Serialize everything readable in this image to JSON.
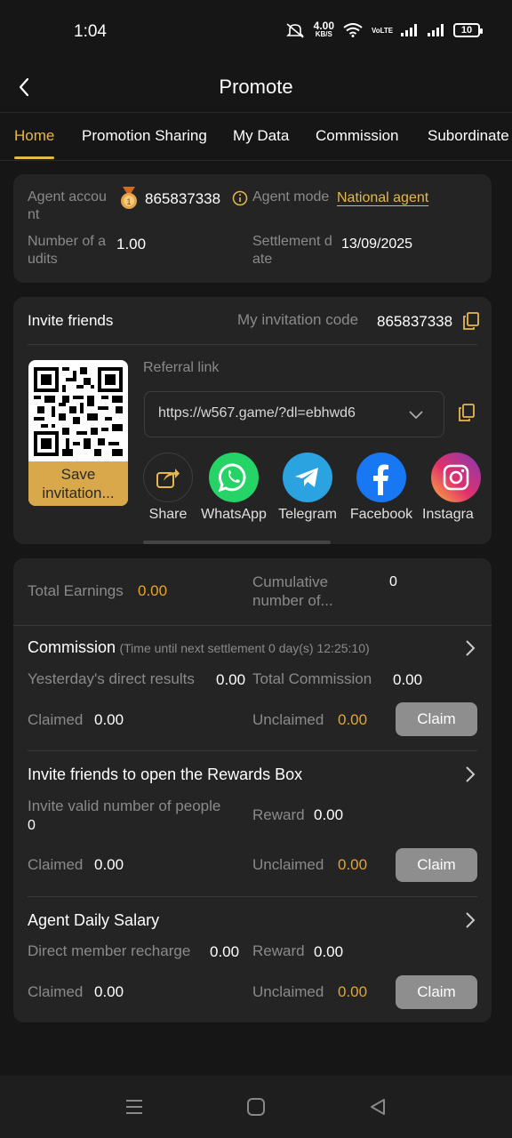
{
  "status": {
    "time": "1:04",
    "speed_top": "4.00",
    "speed_unit": "KB/S",
    "network": "VoLTE",
    "battery": "10"
  },
  "header": {
    "title": "Promote"
  },
  "tabs": [
    {
      "label": "Home"
    },
    {
      "label": "Promotion Sharing"
    },
    {
      "label": "My Data"
    },
    {
      "label": "Commission"
    },
    {
      "label": "Subordinate"
    }
  ],
  "agent": {
    "account_label": "Agent accou nt",
    "account_value": "865837338",
    "mode_label": "Agent mode",
    "mode_value": "National agent",
    "audits_label": "Number of a udits",
    "audits_value": "1.00",
    "settlement_label": "Settlement d ate",
    "settlement_value": "13/09/2025"
  },
  "invite": {
    "title": "Invite friends",
    "code_label": "My invitation code",
    "code_value": "865837338",
    "referral_label": "Referral link",
    "referral_value": "https://w567.game/?dl=ebhwd6",
    "save_label": "Save invitation...",
    "share": [
      {
        "label": "Share",
        "icon": "share-icon",
        "color": "#242424"
      },
      {
        "label": "WhatsApp",
        "icon": "whatsapp-icon",
        "color": "#25d366"
      },
      {
        "label": "Telegram",
        "icon": "telegram-icon",
        "color": "#2aa3e0"
      },
      {
        "label": "Facebook",
        "icon": "facebook-icon",
        "color": "#1877f2"
      },
      {
        "label": "Instagra",
        "icon": "instagram-icon",
        "color": "#d6249f"
      }
    ]
  },
  "earnings": {
    "total_label": "Total Earnings",
    "total_value": "0.00",
    "cumulative_label": "Cumulative number of...",
    "cumulative_value": "0"
  },
  "commission": {
    "title": "Commission",
    "note": "(Time until next settlement 0 day(s) 12:25:10)",
    "yesterday_label": "Yesterday's direct results",
    "yesterday_value": "0.00",
    "total_label": "Total Commission",
    "total_value": "0.00",
    "claimed_label": "Claimed",
    "claimed_value": "0.00",
    "unclaimed_label": "Unclaimed",
    "unclaimed_value": "0.00",
    "claim_label": "Claim"
  },
  "rewards_box": {
    "title": "Invite friends to open the Rewards Box",
    "valid_label": "Invite valid number of people",
    "valid_value": "0",
    "reward_label": "Reward",
    "reward_value": "0.00",
    "claimed_label": "Claimed",
    "claimed_value": "0.00",
    "unclaimed_label": "Unclaimed",
    "unclaimed_value": "0.00",
    "claim_label": "Claim"
  },
  "salary": {
    "title": "Agent Daily Salary",
    "recharge_label": "Direct member recharge",
    "recharge_value": "0.00",
    "reward_label": "Reward",
    "reward_value": "0.00",
    "claimed_label": "Claimed",
    "claimed_value": "0.00",
    "unclaimed_label": "Unclaimed",
    "unclaimed_value": "0.00",
    "claim_label": "Claim"
  },
  "colors": {
    "accent": "#e6b84c",
    "orange_value": "#e6a42e",
    "card": "#242424",
    "background": "#161616"
  }
}
